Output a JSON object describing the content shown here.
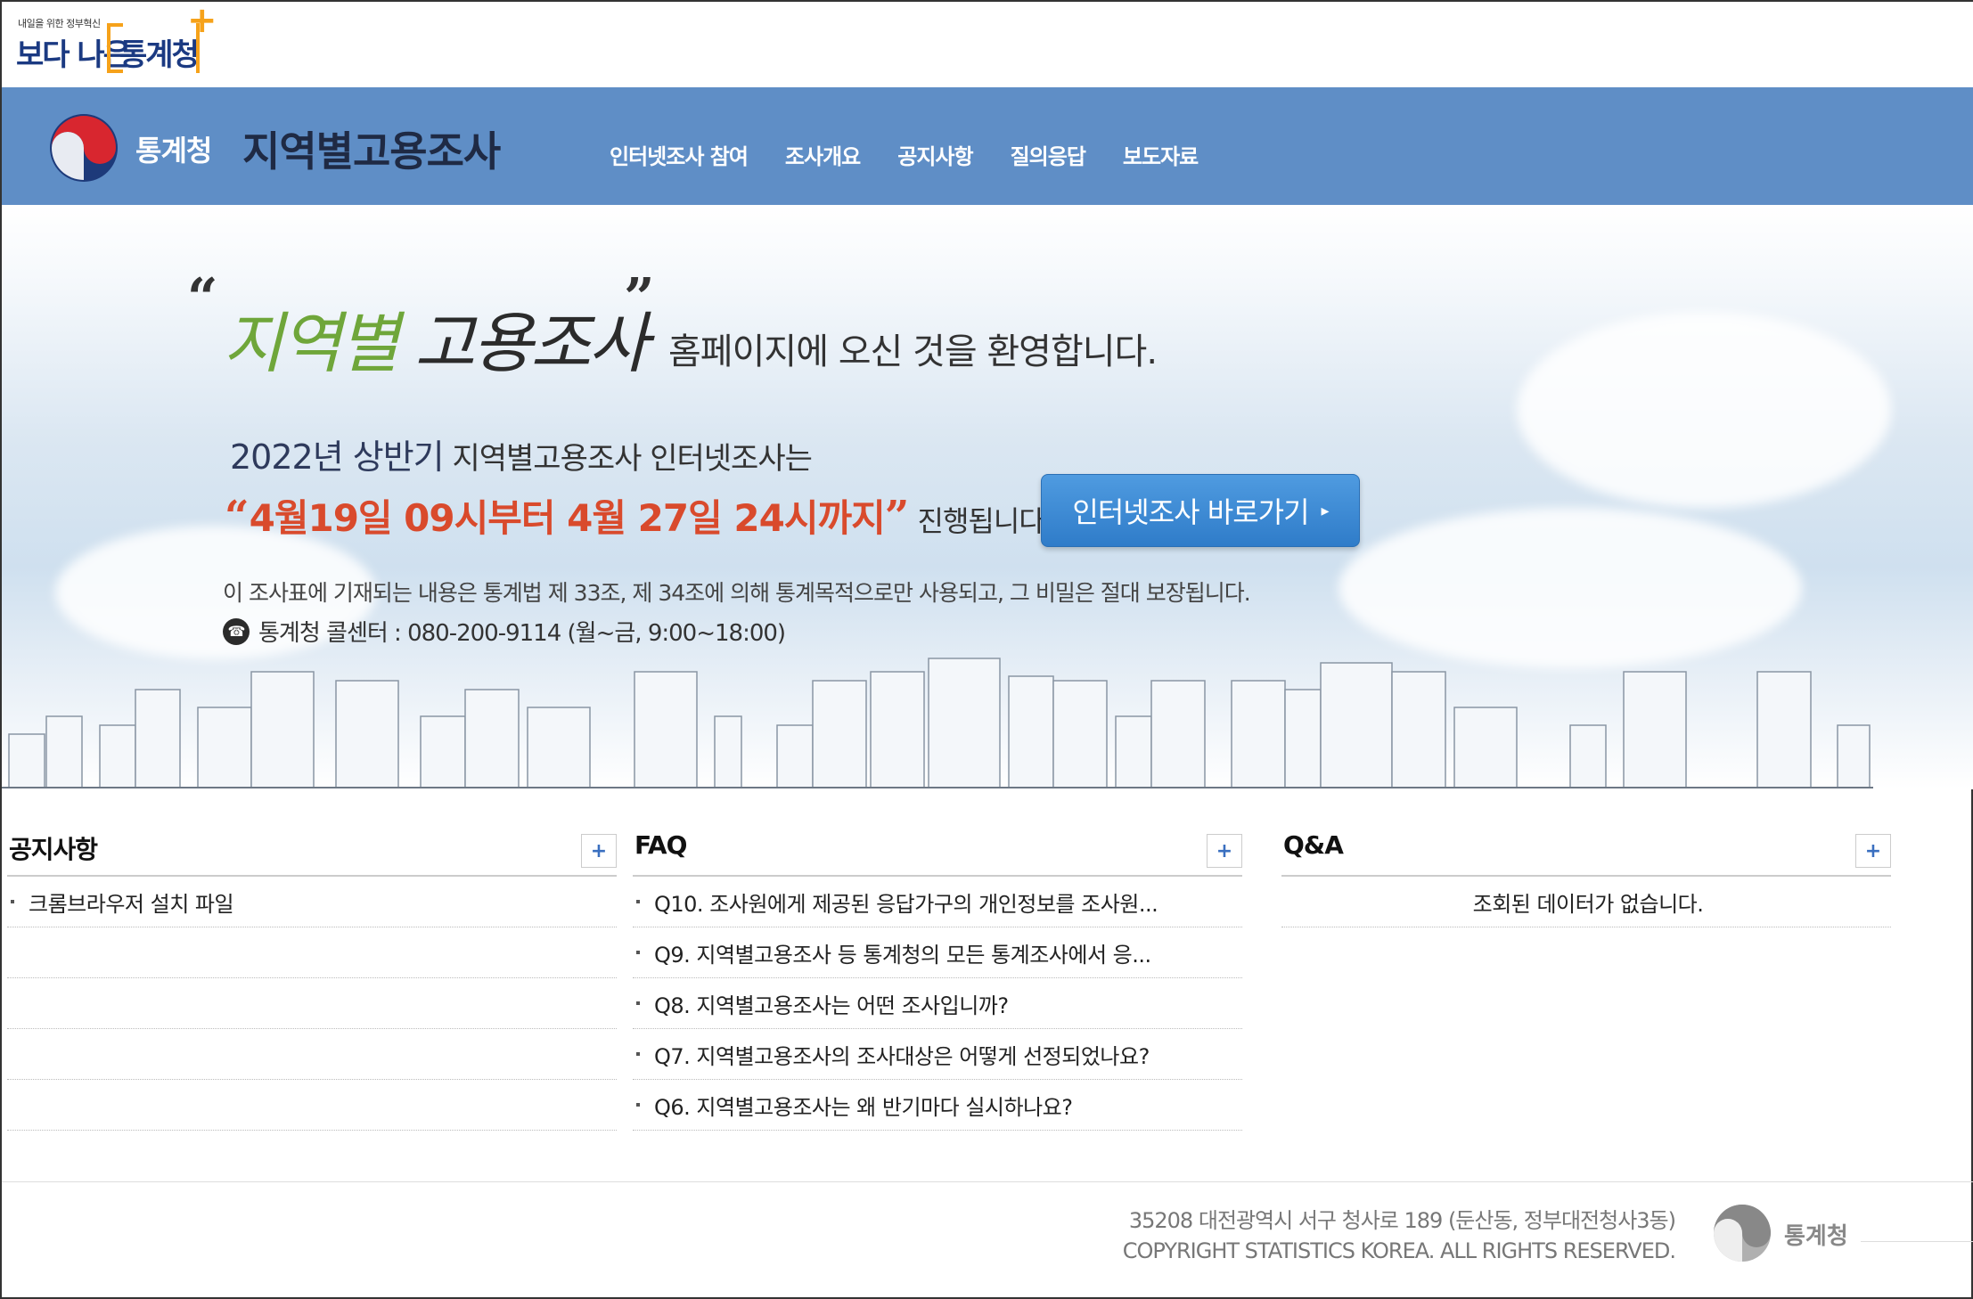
{
  "brand": {
    "tagline": "내일을 위한 정부혁신",
    "left_text": "보다 나은",
    "right_text": "통계청",
    "plus": "+"
  },
  "header": {
    "agency": "통계청",
    "site_title": "지역별고용조사",
    "nav": [
      "인터넷조사 참여",
      "조사개요",
      "공지사항",
      "질의응답",
      "보도자료"
    ]
  },
  "hero": {
    "open_quote": "“",
    "title_green": "지역별",
    "title_dark": "고용조사",
    "close_quote": "”",
    "welcome": "홈페이지에 오신 것을 환영합니다.",
    "period_label": "2022년 상반기",
    "period_text": " 지역별고용조사 인터넷조사는",
    "quote_open": "“",
    "schedule": "4월19일 09시부터  4월 27일 24시까지",
    "quote_close": "”",
    "schedule_suffix": " 진행됩니다.",
    "cta_label": "인터넷조사 바로가기",
    "cta_arrow": "▸",
    "notice": "이 조사표에 기재되는 내용은 통계법 제 33조, 제 34조에 의해 통계목적으로만 사용되고, 그 비밀은 절대 보장됩니다.",
    "callcenter": "통계청 콜센터 : 080-200-9114 (월~금, 9:00~18:00)",
    "phone_icon": "phone-icon"
  },
  "boards": {
    "notice": {
      "title": "공지사항",
      "more": "+",
      "items": [
        "크롬브라우저 설치 파일"
      ]
    },
    "faq": {
      "title": "FAQ",
      "more": "+",
      "items": [
        "Q10. 조사원에게 제공된 응답가구의 개인정보를 조사원...",
        "Q9. 지역별고용조사 등 통계청의 모든 통계조사에서 응...",
        "Q8. 지역별고용조사는 어떤 조사입니까?",
        "Q7. 지역별고용조사의 조사대상은 어떻게 선정되었나요?",
        "Q6. 지역별고용조사는 왜 반기마다 실시하나요?"
      ]
    },
    "qna": {
      "title": "Q&A",
      "more": "+",
      "empty": "조회된 데이터가 없습니다."
    }
  },
  "footer": {
    "address": "35208 대전광역시 서구 청사로 189 (둔산동, 정부대전청사3동)",
    "copyright": "COPYRIGHT STATISTICS KOREA. ALL RIGHTS RESERVED.",
    "agency": "통계청"
  },
  "colors": {
    "header_bg": "#5f8ec6",
    "accent_red": "#d94a2c",
    "accent_green": "#6fa63a",
    "cta_blue": "#2f7cc9"
  }
}
